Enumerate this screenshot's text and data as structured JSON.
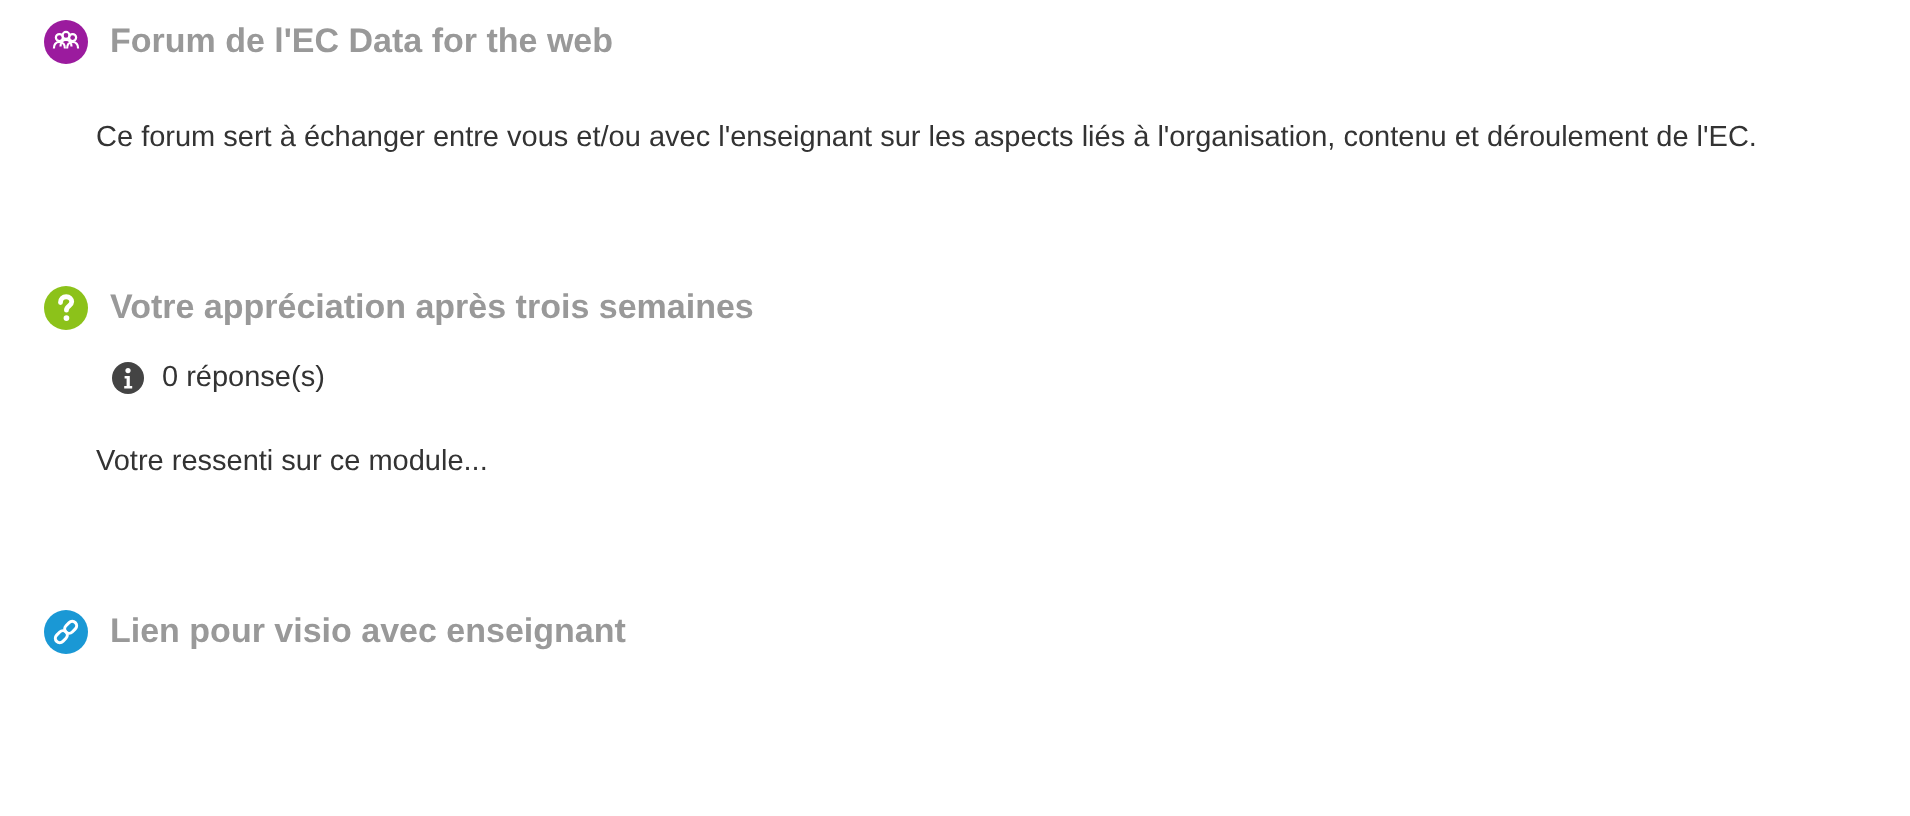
{
  "activities": [
    {
      "kind": "forum",
      "title": "Forum de l'EC Data for the web",
      "description": "Ce forum sert à échanger entre vous et/ou avec l'enseignant sur les aspects liés à l'organisation, contenu et déroulement de l'EC."
    },
    {
      "kind": "feedback",
      "title": "Votre appréciation après trois semaines",
      "info": "0 réponse(s)",
      "description": "Votre ressenti sur ce module..."
    },
    {
      "kind": "url",
      "title": "Lien pour visio avec enseignant"
    }
  ]
}
